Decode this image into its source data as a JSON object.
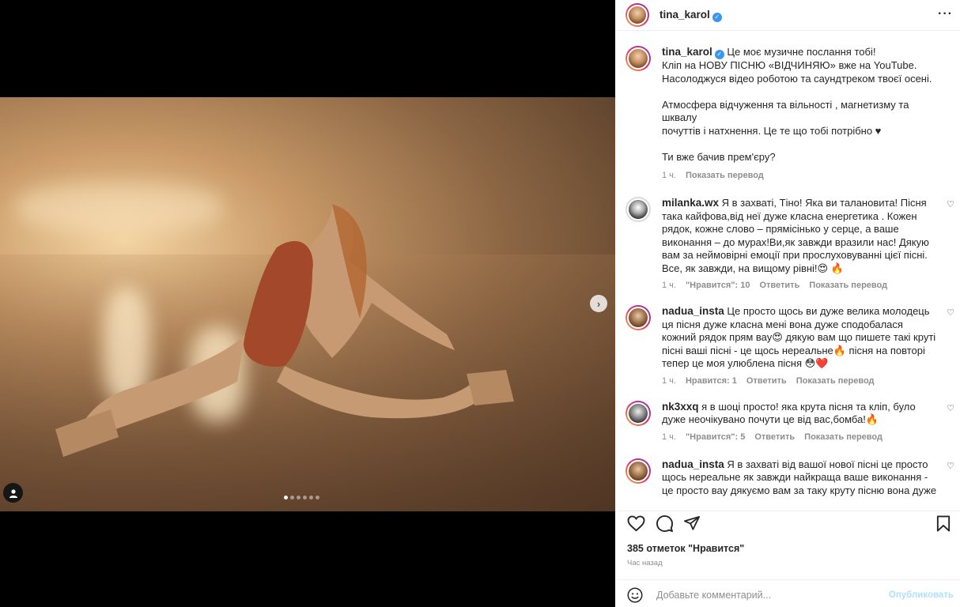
{
  "post": {
    "username": "tina_karol",
    "caption_lines": [
      "Це моє музичне послання тобі!",
      "Кліп на НОВУ ПІСНЮ «ВІДЧИНЯЮ» вже на YouTube.",
      "Насолоджуся відео роботою та саундтреком твоєї осені.",
      "",
      "Атмосфера відчуження та вільності , магнетизму та шквалу",
      "почуттів і натхнення. Це те що тобі потрібно ♥",
      "",
      "Ти вже бачив прем'єру?"
    ],
    "caption_time": "1 ч.",
    "caption_translate": "Показать перевод",
    "likes": "385 отметок \"Нравится\"",
    "posted_ago": "Час назад",
    "comment_placeholder": "Добавьте комментарий...",
    "publish_label": "Опубликовать",
    "carousel": {
      "slides": 6,
      "active": 0
    }
  },
  "comments": [
    {
      "username": "milanka.wx",
      "text": "Я в захваті, Тіно! Яка ви талановита! Пісня така кайфова,від неї дуже класна енергетика . Кожен рядок, кожне слово – прямісінько у серце, а ваше виконання – до мурах!Ви,як завжди вразили нас! Дякую вам за неймовірні емоції при прослуховуванні цієї пісні. Все, як завжди, на вищому рівні!😍 🔥",
      "time": "1 ч.",
      "likes": "\"Нравится\": 10",
      "reply": "Ответить",
      "translate": "Показать перевод"
    },
    {
      "username": "nadua_insta",
      "text": "Це просто щось ви дуже велика молодець ця пісня дуже класна мені вона дуже сподобалася кожний рядок прям вау😍 дякую вам що пишете такі круті пісні ваші пісні - це щось нереальне🔥 пісня на повторі тепер це моя улюблена пісня 😳❤️",
      "time": "1 ч.",
      "likes": "Нравится: 1",
      "reply": "Ответить",
      "translate": "Показать перевод"
    },
    {
      "username": "nk3xxq",
      "text": "я в шоці просто! яка крута пісня та кліп, було дуже неочікувано почути це від вас,бомба!🔥",
      "time": "1 ч.",
      "likes": "\"Нравится\": 5",
      "reply": "Ответить",
      "translate": "Показать перевод"
    },
    {
      "username": "nadua_insta",
      "text": "Я в захваті від вашої нової пісні це просто щось нереальне як завжди найкраща ваше виконання - це просто вау дякуємо вам за таку круту пісню вона дуже",
      "time": "",
      "likes": "",
      "reply": "",
      "translate": ""
    }
  ],
  "icons": [
    "verified-icon",
    "more-icon",
    "heart-icon",
    "comment-icon",
    "share-icon",
    "bookmark-icon",
    "smile-icon",
    "chevron-right-icon",
    "user-tag-icon"
  ]
}
